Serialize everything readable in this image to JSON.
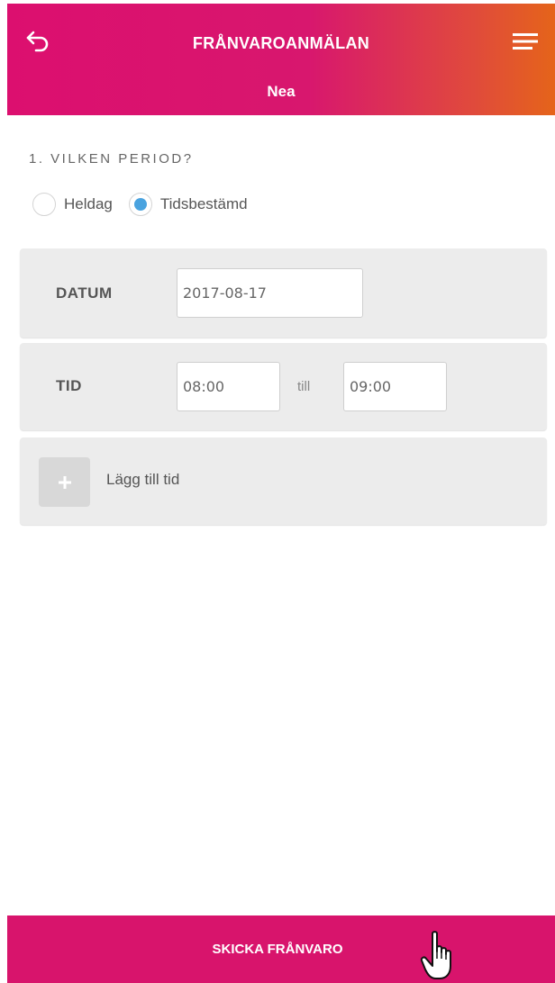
{
  "header": {
    "title": "FRÅNVAROANMÄLAN",
    "subtitle": "Nea",
    "back_icon": "back-arrow-icon",
    "menu_icon": "hamburger-menu-icon"
  },
  "period": {
    "heading": "1. VILKEN PERIOD?",
    "options": [
      {
        "label": "Heldag",
        "selected": false
      },
      {
        "label": "Tidsbestämd",
        "selected": true
      }
    ]
  },
  "date_panel": {
    "label": "DATUM",
    "value": "2017-08-17"
  },
  "time_panel": {
    "label": "TID",
    "from_value": "08:00",
    "separator": "till",
    "to_value": "09:00"
  },
  "add_time": {
    "label": "Lägg till tid",
    "icon": "plus-icon"
  },
  "footer": {
    "submit_label": "SKICKA FRÅNVARO",
    "cursor_icon": "hand-pointer-cursor-icon"
  },
  "colors": {
    "brand_primary": "#d8146c",
    "brand_gradient_end": "#e5641a",
    "radio_selected": "#4aa3df",
    "panel_background": "#ececec"
  }
}
